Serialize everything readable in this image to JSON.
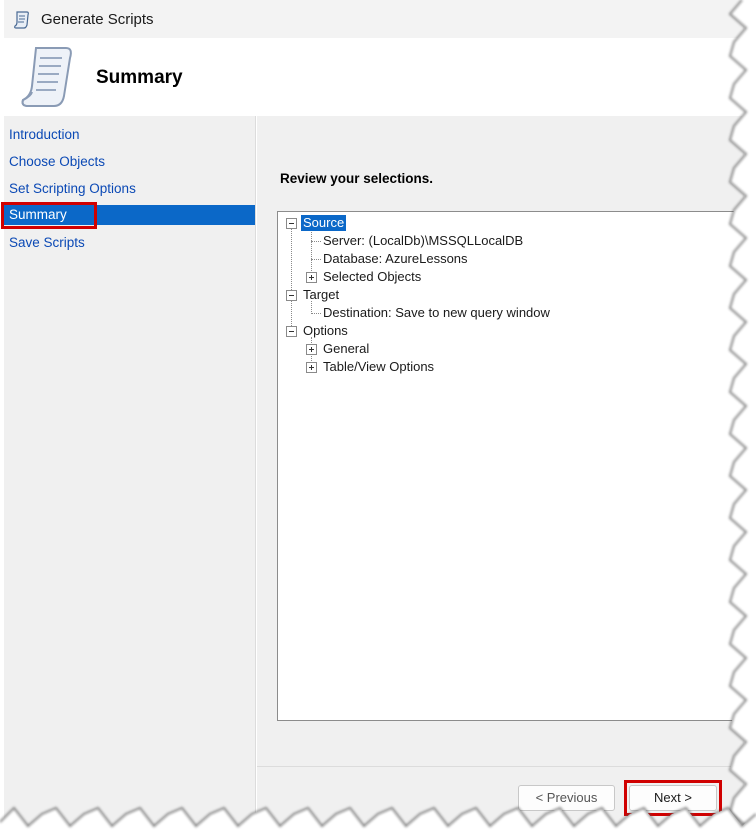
{
  "window": {
    "title": "Generate Scripts",
    "icon": "scroll-icon"
  },
  "header": {
    "heading": "Summary",
    "icon": "scroll-icon"
  },
  "sidebar": {
    "items": [
      {
        "label": "Introduction",
        "selected": false
      },
      {
        "label": "Choose Objects",
        "selected": false
      },
      {
        "label": "Set Scripting Options",
        "selected": false
      },
      {
        "label": "Summary",
        "selected": true
      },
      {
        "label": "Save Scripts",
        "selected": false
      }
    ]
  },
  "main": {
    "instruction": "Review your selections.",
    "tree": {
      "source": {
        "label": "Source",
        "server": "Server: (LocalDb)\\MSSQLLocalDB",
        "database": "Database: AzureLessons",
        "selected_objects": "Selected Objects"
      },
      "target": {
        "label": "Target",
        "destination": "Destination: Save to new query window"
      },
      "options": {
        "label": "Options",
        "general": "General",
        "table_view": "Table/View Options"
      }
    }
  },
  "footer": {
    "previous_label": "< Previous",
    "next_label": "Next >"
  },
  "colors": {
    "selection_blue": "#0b68c8",
    "link_blue": "#0b49b5",
    "highlight_red": "#d00000",
    "panel_gray": "#f0f0f0"
  }
}
